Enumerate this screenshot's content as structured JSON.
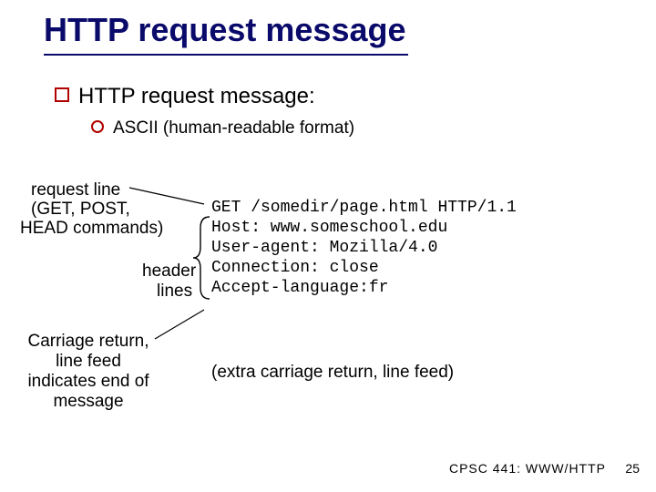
{
  "title": "HTTP request message",
  "bullets": {
    "main": "HTTP request message:",
    "sub": "ASCII (human-readable format)"
  },
  "labels": {
    "request_line_1": "request line",
    "request_line_2": "(GET, POST,",
    "request_line_3": "HEAD commands)",
    "header_1": "header",
    "header_2": "lines",
    "crlf": "Carriage return, line feed indicates end of message"
  },
  "message": {
    "l1": "GET /somedir/page.html HTTP/1.1",
    "l2": "Host: www.someschool.edu",
    "l3": "User-agent: Mozilla/4.0",
    "l4": "Connection: close",
    "l5": "Accept-language:fr"
  },
  "extra": "(extra carriage return, line feed)",
  "footer": {
    "course": "CPSC 441: WWW/HTTP",
    "page": "25"
  }
}
